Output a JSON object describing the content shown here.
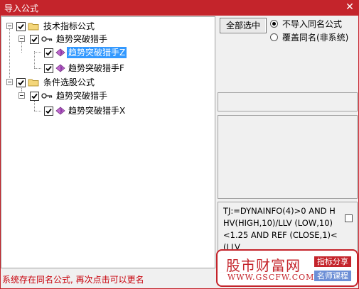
{
  "window": {
    "title": "导入公式",
    "close_glyph": "✕"
  },
  "tree": {
    "groups": [
      {
        "label": "技术指标公式",
        "checked": true,
        "children": [
          {
            "label": "趋势突破猎手",
            "checked": true,
            "formulas": [
              {
                "label": "趋势突破猎手Z",
                "checked": true,
                "selected": true
              },
              {
                "label": "趋势突破猎手F",
                "checked": true,
                "selected": false
              }
            ]
          }
        ]
      },
      {
        "label": "条件选股公式",
        "checked": true,
        "children": [
          {
            "label": "趋势突破猎手",
            "checked": true,
            "formulas": [
              {
                "label": "趋势突破猎手X",
                "checked": true,
                "selected": false
              }
            ]
          }
        ]
      }
    ]
  },
  "right": {
    "select_all_label": "全部选中",
    "options": [
      {
        "label": "不导入同名公式",
        "checked": true
      },
      {
        "label": "覆盖同名(非系统)",
        "checked": false
      }
    ],
    "formula_text": "TJ:=DYNAINFO(4)>0 AND HHV(HIGH,10)/LLV (LOW,10)<1.25 AND REF (CLOSE,1)<(LLV",
    "formula_checked": false
  },
  "status_text": "系统存在同名公式, 再次点击可以更名",
  "watermark": {
    "name": "股市财富网",
    "url": "WWW.GSCFW.COM",
    "tag1": "指标分享",
    "tag2": "名师课程"
  },
  "colors": {
    "accent_red": "#c4242b",
    "selection_blue": "#3399ff",
    "status_red": "#c8000a",
    "tag_blue": "#6d8fd6"
  },
  "icons": {
    "group": "folder-icon",
    "category": "key-icon",
    "formula": "formula-diamond-icon",
    "check": "checkmark-icon"
  }
}
